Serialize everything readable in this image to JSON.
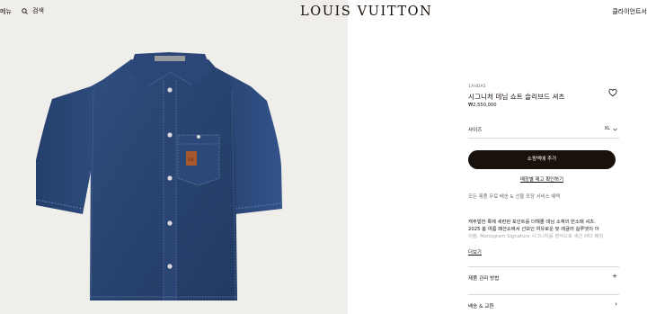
{
  "header": {
    "menu_label": "메뉴",
    "search_label": "검색",
    "logo": "LOUIS VUITTON",
    "contact_label": "클라이언트서"
  },
  "product": {
    "sku": "1AHDA5",
    "name": "시그니처 데님 쇼트 슬리브드 셔츠",
    "price": "₩2,550,000",
    "size_label": "사이즈",
    "size_value": "XL",
    "add_to_bag": "쇼핑백에 추가",
    "store_availability": "매장별 재고 확인하기",
    "service_note": "모든 제품 무료 배송 & 선물 포장 서비스 혜택",
    "description_lines": [
      "캐주얼한 룩에 세련된 포인트를 더해줄 데님 소재의 반소매 셔츠.",
      "2025 봄 여름 패션쇼에서 선보인 여유로운 핏 레귤러 실루엣의 아",
      "이템. Monogram Signature 시그니처를 장식으로 새긴 레더 패치"
    ],
    "read_more": "더보기",
    "accordions": [
      {
        "label": "제품 관리 방법",
        "icon": "+"
      },
      {
        "label": "배송 & 교환",
        "icon": "›"
      }
    ]
  },
  "colors": {
    "brand_dark": "#19110b",
    "image_background": "#f0eeea",
    "denim": "#2d4a7c",
    "muted_text": "#6b6b6b"
  },
  "icons": {
    "menu": "menu-icon",
    "search": "search-icon",
    "wishlist": "heart-icon",
    "size_chevron": "chevron-down-icon"
  }
}
